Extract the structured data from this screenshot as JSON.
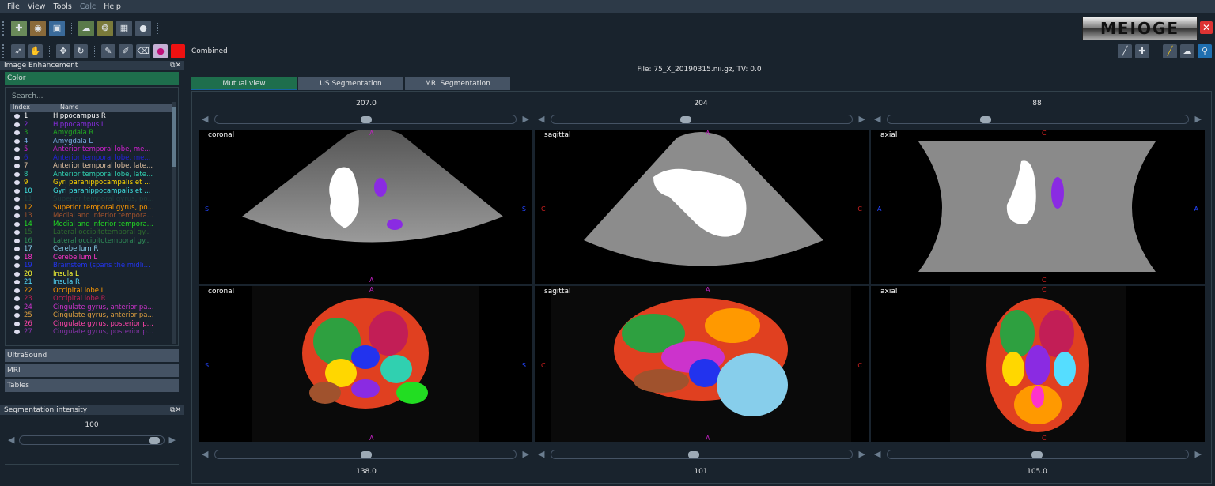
{
  "menu": [
    "File",
    "View",
    "Tools",
    "Calc",
    "Help"
  ],
  "toolbar": {
    "combined_label": "Combined",
    "logo_text": "MEIOGE",
    "close_glyph": "✕"
  },
  "left_dock": {
    "title": "Image Enhancement",
    "section_color": "Color",
    "search_placeholder": "Search...",
    "col_index": "Index",
    "col_name": "Name",
    "rows": [
      {
        "i": "1",
        "n": "Hippocampus R",
        "c": "#ffffff"
      },
      {
        "i": "2",
        "n": "Hippocampus L",
        "c": "#8a2be2"
      },
      {
        "i": "3",
        "n": "Amygdala R",
        "c": "#22aa22"
      },
      {
        "i": "4",
        "n": "Amygdala L",
        "c": "#7ab0e8"
      },
      {
        "i": "5",
        "n": "Anterior temporal lobe, me...",
        "c": "#d020d0"
      },
      {
        "i": "6",
        "n": "Anterior temporal lobe, me...",
        "c": "#2222dd"
      },
      {
        "i": "7",
        "n": "Anterior temporal lobe, late...",
        "c": "#e0c0a0"
      },
      {
        "i": "8",
        "n": "Anterior temporal lobe, late...",
        "c": "#30d0b0"
      },
      {
        "i": "9",
        "n": "Gyri parahippocampalis et a...",
        "c": "#ffd700"
      },
      {
        "i": "10",
        "n": "Gyri parahippocampalis et a...",
        "c": "#40e0e0"
      },
      {
        "i": "11",
        "n": "Superior temporal gyrus, po...",
        "c": "#1e3a3a"
      },
      {
        "i": "12",
        "n": "Superior temporal gyrus, po...",
        "c": "#ff9900"
      },
      {
        "i": "13",
        "n": "Medial and inferior tempora...",
        "c": "#a0522d"
      },
      {
        "i": "14",
        "n": "Medial and inferior tempora...",
        "c": "#22dd22"
      },
      {
        "i": "15",
        "n": "Lateral occipitotemporal gy...",
        "c": "#2e6b2e"
      },
      {
        "i": "16",
        "n": "Lateral occipitotemporal gy...",
        "c": "#2e8b57"
      },
      {
        "i": "17",
        "n": "Cerebellum R",
        "c": "#87ceeb"
      },
      {
        "i": "18",
        "n": "Cerebellum L",
        "c": "#ff33cc"
      },
      {
        "i": "19",
        "n": "Brainstem (spans the midline)",
        "c": "#2233ee"
      },
      {
        "i": "20",
        "n": "Insula L",
        "c": "#ffff33"
      },
      {
        "i": "21",
        "n": "Insula R",
        "c": "#55ddff"
      },
      {
        "i": "22",
        "n": "Occipital lobe L",
        "c": "#ff9900"
      },
      {
        "i": "23",
        "n": "Occipital lobe R",
        "c": "#c21e56"
      },
      {
        "i": "24",
        "n": "Cingulate gyrus, anterior pa...",
        "c": "#cc33cc"
      },
      {
        "i": "25",
        "n": "Cingulate gyrus, anterior pa...",
        "c": "#e0a040"
      },
      {
        "i": "26",
        "n": "Cingulate gyrus, posterior p...",
        "c": "#ff44aa"
      },
      {
        "i": "27",
        "n": "Cingulate gyrus, posterior p...",
        "c": "#8833aa"
      }
    ],
    "sections": [
      "UltraSound",
      "MRI",
      "Tables"
    ]
  },
  "seg_dock": {
    "title": "Segmentation intensity",
    "value": "100",
    "level": 0.97
  },
  "main": {
    "file_label": "File: 75_X_20190315.nii.gz, TV: 0.0",
    "tabs": [
      "Mutual view",
      "US Segmentation",
      "MRI Segmentation"
    ],
    "top_values": [
      "207.0",
      "204",
      "88"
    ],
    "bottom_values": [
      "138.0",
      "101",
      "105.0"
    ],
    "view_labels": [
      "coronal",
      "sagittal",
      "axial"
    ],
    "ori": {
      "a": "A",
      "s": "S",
      "c": "C"
    }
  }
}
